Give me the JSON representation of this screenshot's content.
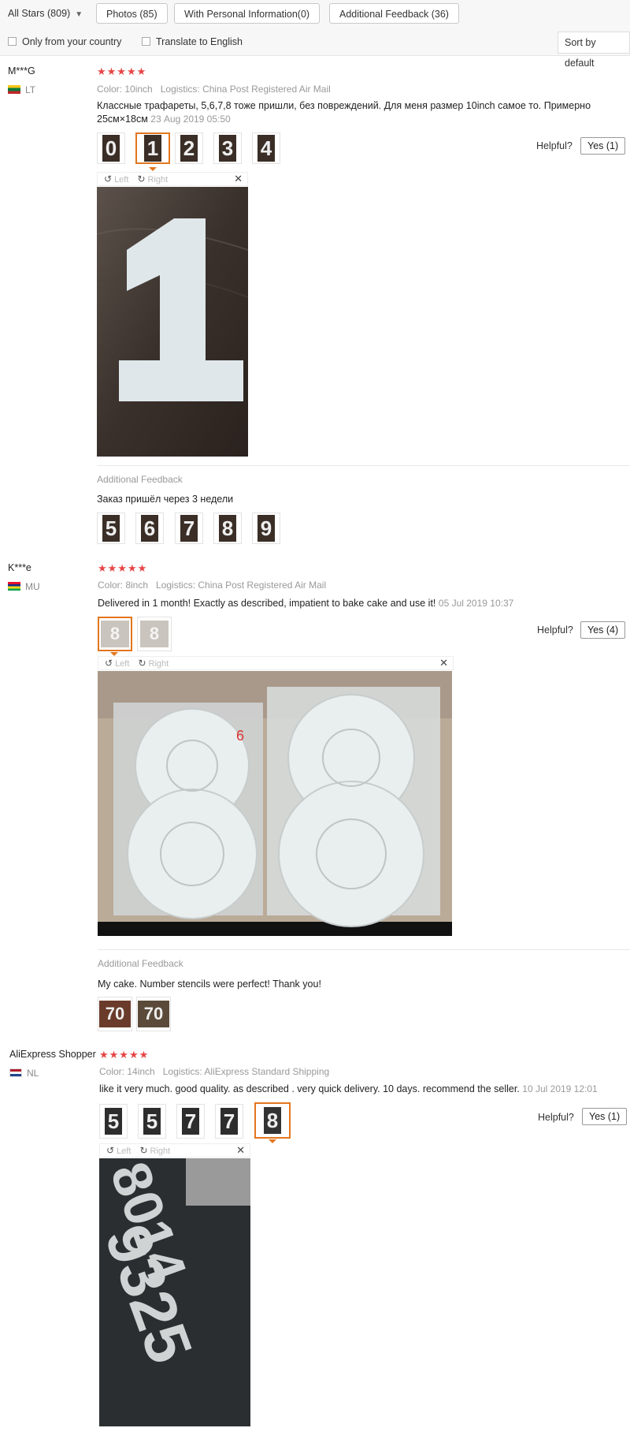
{
  "filters": {
    "stars_label": "All Stars (809)",
    "photos_label": "Photos (85)",
    "personal_info_label": "With Personal Information(0)",
    "additional_feedback_label": "Additional Feedback (36)",
    "only_country_label": "Only from your country",
    "translate_label": "Translate to English",
    "sort_label": "Sort by default"
  },
  "image_toolbar": {
    "left": "Left",
    "right": "Right"
  },
  "helpful_label": "Helpful?",
  "additional_feedback_heading": "Additional Feedback",
  "reviews": [
    {
      "user": "M***G",
      "country": "LT",
      "stars": "★★★★★",
      "color": "Color: 10inch",
      "logistics": "Logistics: China Post Registered Air Mail",
      "text": "Классные трафареты, 5,6,7,8 тоже пришли, без повреждений. Для меня размер 10inch самое то. Примерно 25см×18см",
      "date": "23 Aug 2019 05:50",
      "thumbs": [
        "0",
        "1",
        "2",
        "3",
        "4"
      ],
      "helpful_count": "Yes (1)",
      "additional_text": "Заказ пришёл через 3 недели",
      "additional_thumbs": [
        "5",
        "6",
        "7",
        "8",
        "9"
      ]
    },
    {
      "user": "K***e",
      "country": "MU",
      "stars": "★★★★★",
      "color": "Color: 8inch",
      "logistics": "Logistics: China Post Registered Air Mail",
      "text": "Delivered in 1 month! Exactly as described, impatient to bake cake and use it!",
      "date": "05 Jul 2019 10:37",
      "thumbs": [
        "8",
        "8"
      ],
      "helpful_count": "Yes (4)",
      "additional_text": "My cake. Number stencils were perfect! Thank you!",
      "additional_thumbs": [
        "70",
        "70"
      ]
    },
    {
      "user": "AliExpress Shopper",
      "country": "NL",
      "stars": "★★★★★",
      "color": "Color: 14inch",
      "logistics": "Logistics: AliExpress Standard Shipping",
      "text": "like it very much. good quality. as described . very quick delivery. 10 days. recommend the seller.",
      "date": "10 Jul 2019 12:01",
      "thumbs": [
        "5",
        "5",
        "7",
        "7",
        "8"
      ],
      "helpful_count": "Yes (1)"
    }
  ]
}
